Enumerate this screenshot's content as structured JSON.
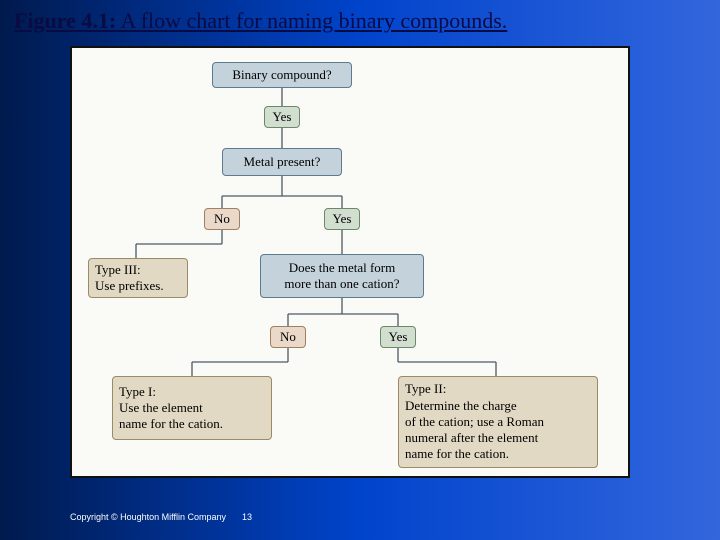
{
  "title": {
    "figlabel": "Figure 4.1:",
    "caption": " A flow chart for naming binary compounds."
  },
  "nodes": {
    "q1": "Binary compound?",
    "a1": "Yes",
    "q2": "Metal present?",
    "noL": "No",
    "yesR": "Yes",
    "type3": "Type III:\nUse prefixes.",
    "q3": "Does the metal form\nmore than one cation?",
    "no2": "No",
    "yes2": "Yes",
    "type1": "Type I:\nUse the element\nname for the cation.",
    "type2": "Type II:\nDetermine the charge\nof the cation; use a Roman\nnumeral  after the element\nname for the cation."
  },
  "footer": {
    "copyright": "Copyright © Houghton Mifflin Company",
    "page": "13"
  }
}
